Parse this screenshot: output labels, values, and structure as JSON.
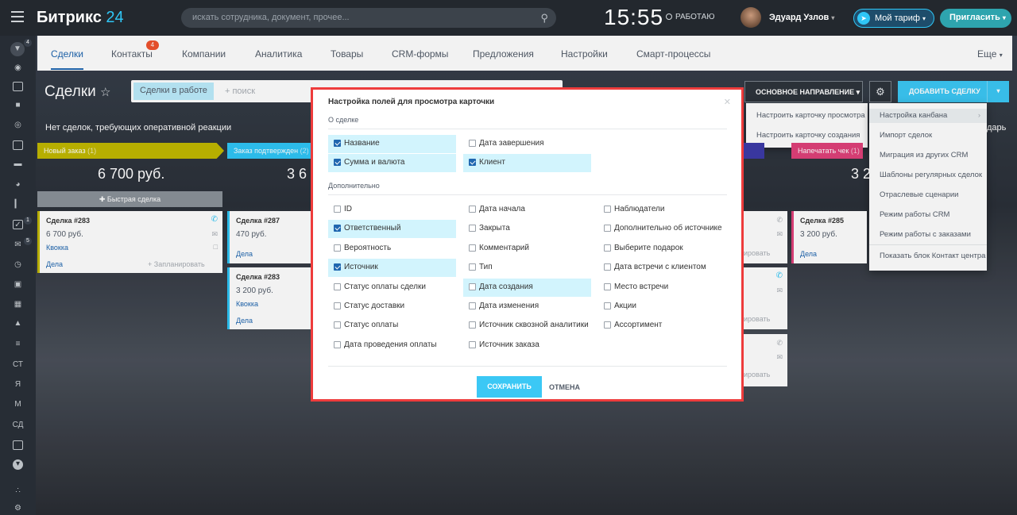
{
  "header": {
    "logo_name": "Битрикс",
    "logo_num": "24",
    "search_placeholder": "искать сотрудника, документ, прочее...",
    "clock": "15:55",
    "work_status": "РАБОТАЮ",
    "user_name": "Эдуард Узлов",
    "tariff": "Мой тариф",
    "invite": "Пригласить"
  },
  "sidebar": {
    "badges": [
      "4",
      "1",
      "5"
    ],
    "labels": [
      "СТ",
      "Я",
      "М",
      "СД"
    ]
  },
  "tabs": {
    "items": [
      "Сделки",
      "Контакты",
      "Компании",
      "Аналитика",
      "Товары",
      "CRM-формы",
      "Предложения",
      "Настройки",
      "Смарт-процессы"
    ],
    "contacts_badge": "4",
    "more": "Еще"
  },
  "page": {
    "title": "Сделки",
    "filter_chip": "Сделки в работе",
    "filter_placeholder": "+ поиск",
    "notice": "Нет сделок, требующих оперативной реакции",
    "notice_tail": "дарь",
    "direction": "ОСНОВНОЕ НАПРАВЛЕНИЕ",
    "add_deal": "ДОБАВИТЬ СДЕЛКУ"
  },
  "direction_menu": [
    "Настроить карточку просмотра",
    "Настроить карточку создания"
  ],
  "gear_menu": [
    "Настройка канбана",
    "Импорт сделок",
    "Миграция из других CRM",
    "Шаблоны регулярных сделок",
    "Отраслевые сценарии",
    "Режим работы CRM",
    "Режим работы с заказами",
    "Показать блок Контакт центра"
  ],
  "kanban": {
    "columns": [
      {
        "name": "Новый заказ",
        "count": "(1)",
        "sum": "6 700 руб.",
        "color": "#c1b800"
      },
      {
        "name": "Заказ подтвержден",
        "count": "(2)",
        "sum": "3 6",
        "color": "#2fc6f6"
      },
      {
        "name": "Напечатать чек",
        "count": "(1)",
        "sum": "3 2",
        "color": "#e0417a"
      }
    ],
    "quick_deal": "Быстрая сделка",
    "cards": [
      {
        "title": "Сделка #283",
        "price": "6 700 руб.",
        "contact": "Квокка",
        "deals": "Дела",
        "schedule": "+ Запланировать"
      },
      {
        "title": "Сделка #287",
        "price": "470 руб.",
        "deals": "Дела"
      },
      {
        "title": "Сделка #283",
        "price": "3 200 руб.",
        "contact": "Квокка",
        "deals": "Дела"
      },
      {
        "title": "Сделка #285",
        "price": "3 200 руб.",
        "deals": "Дела"
      }
    ],
    "partial_schedule": "ировать"
  },
  "modal": {
    "title": "Настройка полей для просмотра карточки",
    "section_about": "О сделке",
    "section_extra": "Дополнительно",
    "about_fields": [
      {
        "label": "Название",
        "checked": true,
        "highlight": true
      },
      {
        "label": "Дата завершения",
        "checked": false,
        "highlight": false
      },
      {
        "label": "Сумма и валюта",
        "checked": true,
        "highlight": true
      },
      {
        "label": "Клиент",
        "checked": true,
        "highlight": true
      }
    ],
    "extra_fields": [
      {
        "label": "ID",
        "checked": false,
        "highlight": false
      },
      {
        "label": "Дата начала",
        "checked": false,
        "highlight": false
      },
      {
        "label": "Наблюдатели",
        "checked": false,
        "highlight": false
      },
      {
        "label": "Ответственный",
        "checked": true,
        "highlight": true
      },
      {
        "label": "Закрыта",
        "checked": false,
        "highlight": false
      },
      {
        "label": "Дополнительно об источнике",
        "checked": false,
        "highlight": false
      },
      {
        "label": "Вероятность",
        "checked": false,
        "highlight": false
      },
      {
        "label": "Комментарий",
        "checked": false,
        "highlight": false
      },
      {
        "label": "Выберите подарок",
        "checked": false,
        "highlight": false
      },
      {
        "label": "Источник",
        "checked": true,
        "highlight": true
      },
      {
        "label": "Тип",
        "checked": false,
        "highlight": false
      },
      {
        "label": "Дата встречи с клиентом",
        "checked": false,
        "highlight": false
      },
      {
        "label": "Статус оплаты сделки",
        "checked": false,
        "highlight": false
      },
      {
        "label": "Дата создания",
        "checked": false,
        "highlight": true
      },
      {
        "label": "Место встречи",
        "checked": false,
        "highlight": false
      },
      {
        "label": "Статус доставки",
        "checked": false,
        "highlight": false
      },
      {
        "label": "Дата изменения",
        "checked": false,
        "highlight": false
      },
      {
        "label": "Акции",
        "checked": false,
        "highlight": false
      },
      {
        "label": "Статус оплаты",
        "checked": false,
        "highlight": false
      },
      {
        "label": "Источник сквозной аналитики",
        "checked": false,
        "highlight": false
      },
      {
        "label": "Ассортимент",
        "checked": false,
        "highlight": false
      },
      {
        "label": "Дата проведения оплаты",
        "checked": false,
        "highlight": false
      },
      {
        "label": "Источник заказа",
        "checked": false,
        "highlight": false
      }
    ],
    "save": "СОХРАНИТЬ",
    "cancel": "ОТМЕНА"
  }
}
